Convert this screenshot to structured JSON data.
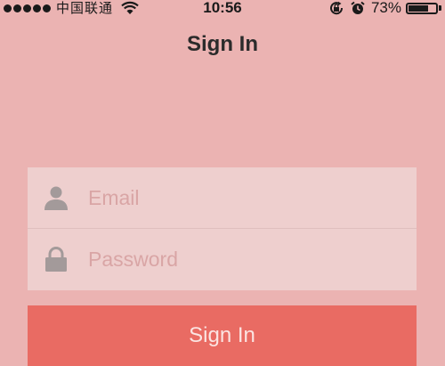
{
  "status_bar": {
    "carrier": "中国联通",
    "time": "10:56",
    "battery_percent": "73%",
    "battery_level": 0.73,
    "icons": [
      "signal-dots-icon",
      "wifi-icon",
      "rotation-lock-icon",
      "alarm-icon",
      "battery-icon"
    ]
  },
  "nav": {
    "title": "Sign In"
  },
  "form": {
    "email_placeholder": "Email",
    "email_value": "",
    "password_placeholder": "Password",
    "password_value": "",
    "icons": [
      "user-icon",
      "lock-icon"
    ]
  },
  "actions": {
    "signin_label": "Sign In"
  },
  "colors": {
    "background": "#ebb3b2",
    "button": "#e96b63",
    "button_text": "#fbe4e2",
    "field_bg": "#eed5d4",
    "placeholder": "#d9a5a5",
    "icon": "#a39a9a"
  }
}
